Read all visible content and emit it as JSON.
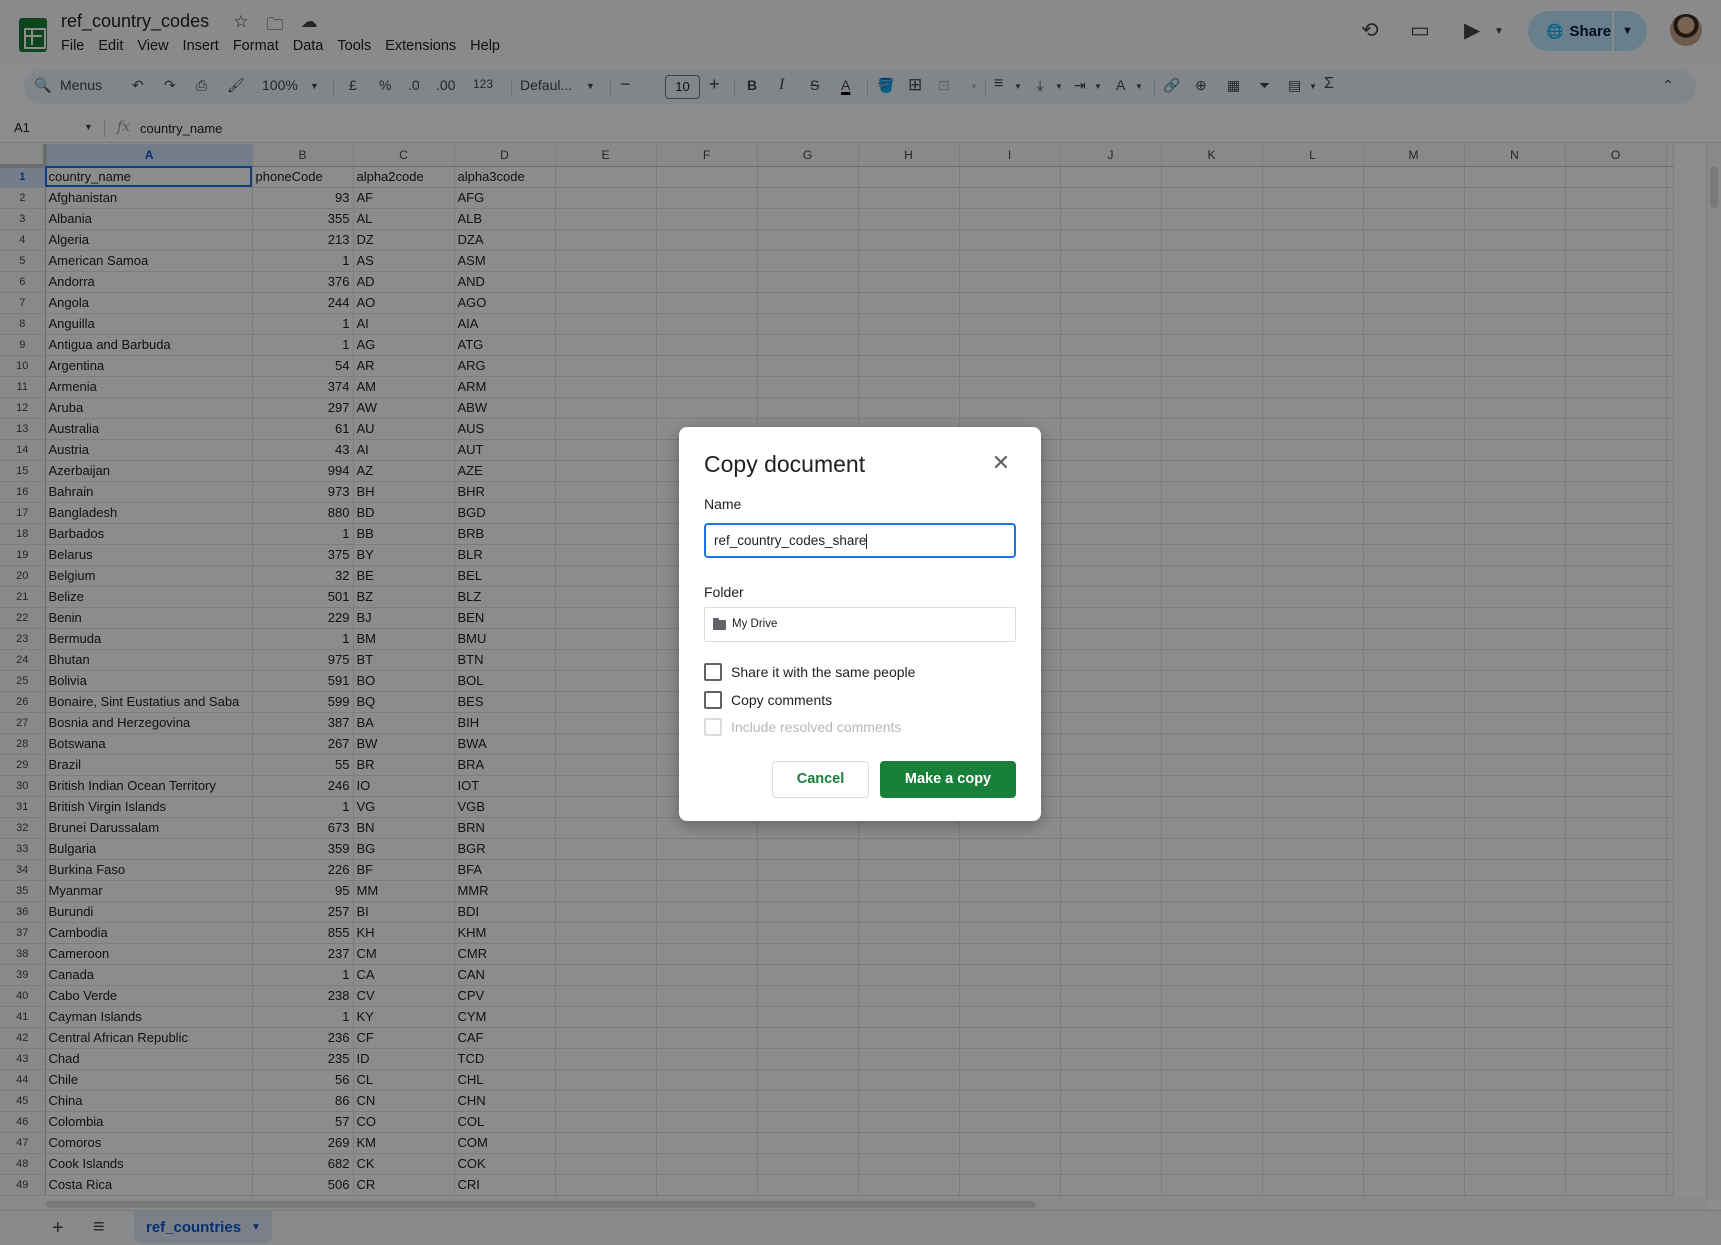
{
  "app": {
    "doc_title": "ref_country_codes",
    "menus": [
      "File",
      "Edit",
      "View",
      "Insert",
      "Format",
      "Data",
      "Tools",
      "Extensions",
      "Help"
    ],
    "share_label": "Share"
  },
  "toolbar": {
    "search_label": "Menus",
    "zoom": "100%",
    "currency": "£",
    "percent": "%",
    "dec_decrease": ".0",
    "dec_increase": ".00",
    "number_format": "123",
    "font": "Defaul...",
    "font_size": "10",
    "bold": "B",
    "italic": "I",
    "strike": "S",
    "text_color": "A"
  },
  "formula_bar": {
    "cell_ref": "A1",
    "fx": "fx",
    "value": "country_name"
  },
  "grid": {
    "columns": [
      "A",
      "B",
      "C",
      "D",
      "E",
      "F",
      "G",
      "H",
      "I",
      "J",
      "K",
      "L",
      "M",
      "N",
      "O"
    ],
    "header_row": [
      "country_name",
      "phoneCode",
      "alpha2code",
      "alpha3code"
    ],
    "rows": [
      [
        "Afghanistan",
        "93",
        "AF",
        "AFG"
      ],
      [
        "Albania",
        "355",
        "AL",
        "ALB"
      ],
      [
        "Algeria",
        "213",
        "DZ",
        "DZA"
      ],
      [
        "American Samoa",
        "1",
        "AS",
        "ASM"
      ],
      [
        "Andorra",
        "376",
        "AD",
        "AND"
      ],
      [
        "Angola",
        "244",
        "AO",
        "AGO"
      ],
      [
        "Anguilla",
        "1",
        "AI",
        "AIA"
      ],
      [
        "Antigua and Barbuda",
        "1",
        "AG",
        "ATG"
      ],
      [
        "Argentina",
        "54",
        "AR",
        "ARG"
      ],
      [
        "Armenia",
        "374",
        "AM",
        "ARM"
      ],
      [
        "Aruba",
        "297",
        "AW",
        "ABW"
      ],
      [
        "Australia",
        "61",
        "AU",
        "AUS"
      ],
      [
        "Austria",
        "43",
        "AI",
        "AUT"
      ],
      [
        "Azerbaijan",
        "994",
        "AZ",
        "AZE"
      ],
      [
        "Bahrain",
        "973",
        "BH",
        "BHR"
      ],
      [
        "Bangladesh",
        "880",
        "BD",
        "BGD"
      ],
      [
        "Barbados",
        "1",
        "BB",
        "BRB"
      ],
      [
        "Belarus",
        "375",
        "BY",
        "BLR"
      ],
      [
        "Belgium",
        "32",
        "BE",
        "BEL"
      ],
      [
        "Belize",
        "501",
        "BZ",
        "BLZ"
      ],
      [
        "Benin",
        "229",
        "BJ",
        "BEN"
      ],
      [
        "Bermuda",
        "1",
        "BM",
        "BMU"
      ],
      [
        "Bhutan",
        "975",
        "BT",
        "BTN"
      ],
      [
        "Bolivia",
        "591",
        "BO",
        "BOL"
      ],
      [
        "Bonaire, Sint Eustatius and Saba",
        "599",
        "BQ",
        "BES"
      ],
      [
        "Bosnia and Herzegovina",
        "387",
        "BA",
        "BIH"
      ],
      [
        "Botswana",
        "267",
        "BW",
        "BWA"
      ],
      [
        "Brazil",
        "55",
        "BR",
        "BRA"
      ],
      [
        "British Indian Ocean Territory",
        "246",
        "IO",
        "IOT"
      ],
      [
        "British Virgin Islands",
        "1",
        "VG",
        "VGB"
      ],
      [
        "Brunei Darussalam",
        "673",
        "BN",
        "BRN"
      ],
      [
        "Bulgaria",
        "359",
        "BG",
        "BGR"
      ],
      [
        "Burkina Faso",
        "226",
        "BF",
        "BFA"
      ],
      [
        "Myanmar",
        "95",
        "MM",
        "MMR"
      ],
      [
        "Burundi",
        "257",
        "BI",
        "BDI"
      ],
      [
        "Cambodia",
        "855",
        "KH",
        "KHM"
      ],
      [
        "Cameroon",
        "237",
        "CM",
        "CMR"
      ],
      [
        "Canada",
        "1",
        "CA",
        "CAN"
      ],
      [
        "Cabo Verde",
        "238",
        "CV",
        "CPV"
      ],
      [
        "Cayman Islands",
        "1",
        "KY",
        "CYM"
      ],
      [
        "Central African Republic",
        "236",
        "CF",
        "CAF"
      ],
      [
        "Chad",
        "235",
        "ID",
        "TCD"
      ],
      [
        "Chile",
        "56",
        "CL",
        "CHL"
      ],
      [
        "China",
        "86",
        "CN",
        "CHN"
      ],
      [
        "Colombia",
        "57",
        "CO",
        "COL"
      ],
      [
        "Comoros",
        "269",
        "KM",
        "COM"
      ],
      [
        "Cook Islands",
        "682",
        "CK",
        "COK"
      ],
      [
        "Costa Rica",
        "506",
        "CR",
        "CRI"
      ]
    ]
  },
  "sheets": {
    "active_tab": "ref_countries"
  },
  "dialog": {
    "title": "Copy document",
    "name_label": "Name",
    "name_value": "ref_country_codes_share",
    "folder_label": "Folder",
    "folder_value": "My Drive",
    "options": [
      {
        "label": "Share it with the same people",
        "checked": false,
        "disabled": false
      },
      {
        "label": "Copy comments",
        "checked": false,
        "disabled": false
      },
      {
        "label": "Include resolved comments",
        "checked": false,
        "disabled": true
      }
    ],
    "cancel_label": "Cancel",
    "confirm_label": "Make a copy"
  },
  "colors": {
    "accent_blue": "#1a73e8",
    "sheets_green": "#188038",
    "share_button": "#c2e7ff"
  }
}
